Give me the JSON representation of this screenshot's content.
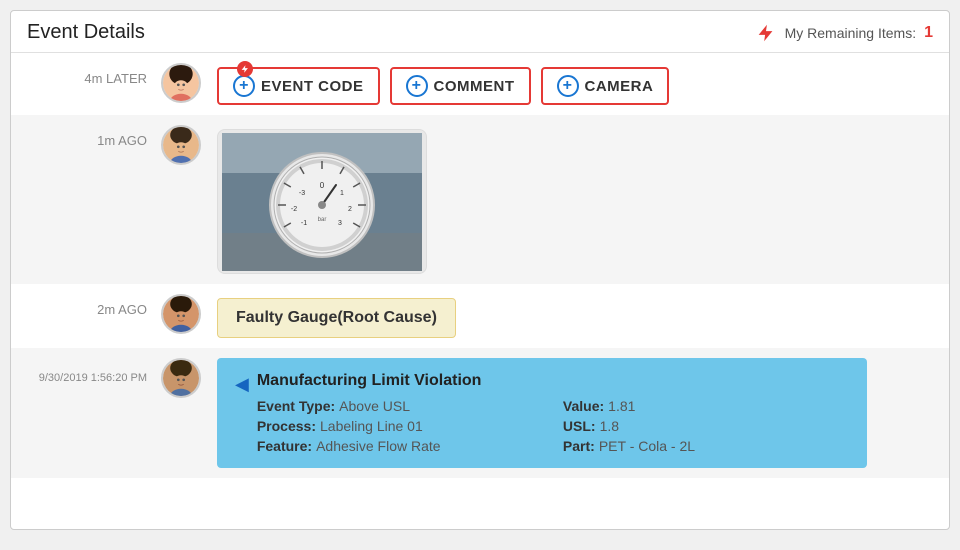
{
  "header": {
    "title": "Event Details",
    "remaining_label": "My Remaining Items:",
    "remaining_count": "1"
  },
  "buttons": {
    "event_code": "EVENT CODE",
    "comment": "COMMENT",
    "camera": "CAMERA",
    "plus_symbol": "+"
  },
  "timeline": [
    {
      "time": "4m LATER",
      "avatar_type": "1",
      "content_type": "action_buttons"
    },
    {
      "time": "1m AGO",
      "avatar_type": "2",
      "content_type": "gauge_image"
    },
    {
      "time": "2m AGO",
      "avatar_type": "3",
      "content_type": "faulty_label",
      "label_text": "Faulty Gauge(Root Cause)"
    },
    {
      "time": "9/30/2019 1:56:20 PM",
      "avatar_type": "4",
      "content_type": "event_card",
      "card": {
        "title": "Manufacturing Limit Violation",
        "event_type_label": "Event Type:",
        "event_type_value": "Above USL",
        "process_label": "Process:",
        "process_value": "Labeling Line 01",
        "feature_label": "Feature:",
        "feature_value": "Adhesive Flow Rate",
        "value_label": "Value:",
        "value_value": "1.81",
        "usl_label": "USL:",
        "usl_value": "1.8",
        "part_label": "Part:",
        "part_value": "PET - Cola - 2L"
      }
    }
  ]
}
